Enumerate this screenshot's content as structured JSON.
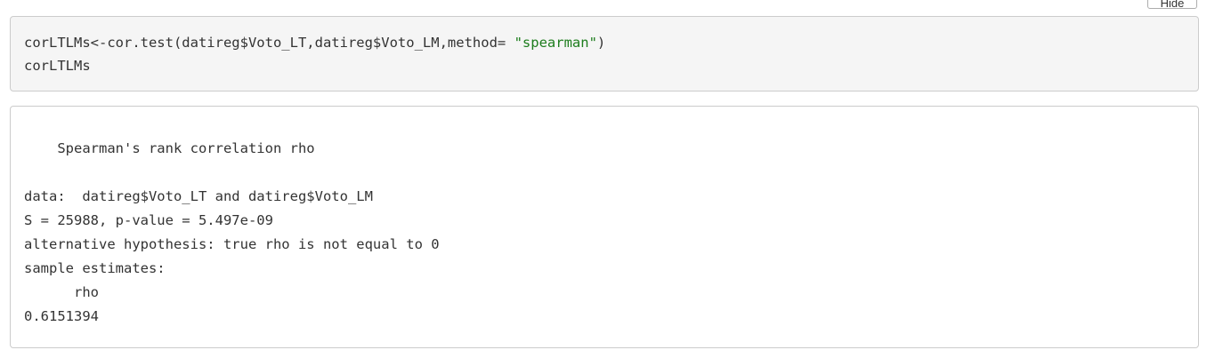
{
  "hide_button": {
    "label": "Hide"
  },
  "code": {
    "line1_prefix": "corLTLMs<-cor.test(datireg$Voto_LT,datireg$Voto_LM,method= ",
    "line1_string": "\"spearman\"",
    "line1_suffix": ")",
    "line2": "corLTLMs"
  },
  "output": {
    "lines": [
      "",
      "    Spearman's rank correlation rho",
      "",
      "data:  datireg$Voto_LT and datireg$Voto_LM",
      "S = 25988, p-value = 5.497e-09",
      "alternative hypothesis: true rho is not equal to 0",
      "sample estimates:",
      "      rho ",
      "0.6151394 "
    ]
  }
}
